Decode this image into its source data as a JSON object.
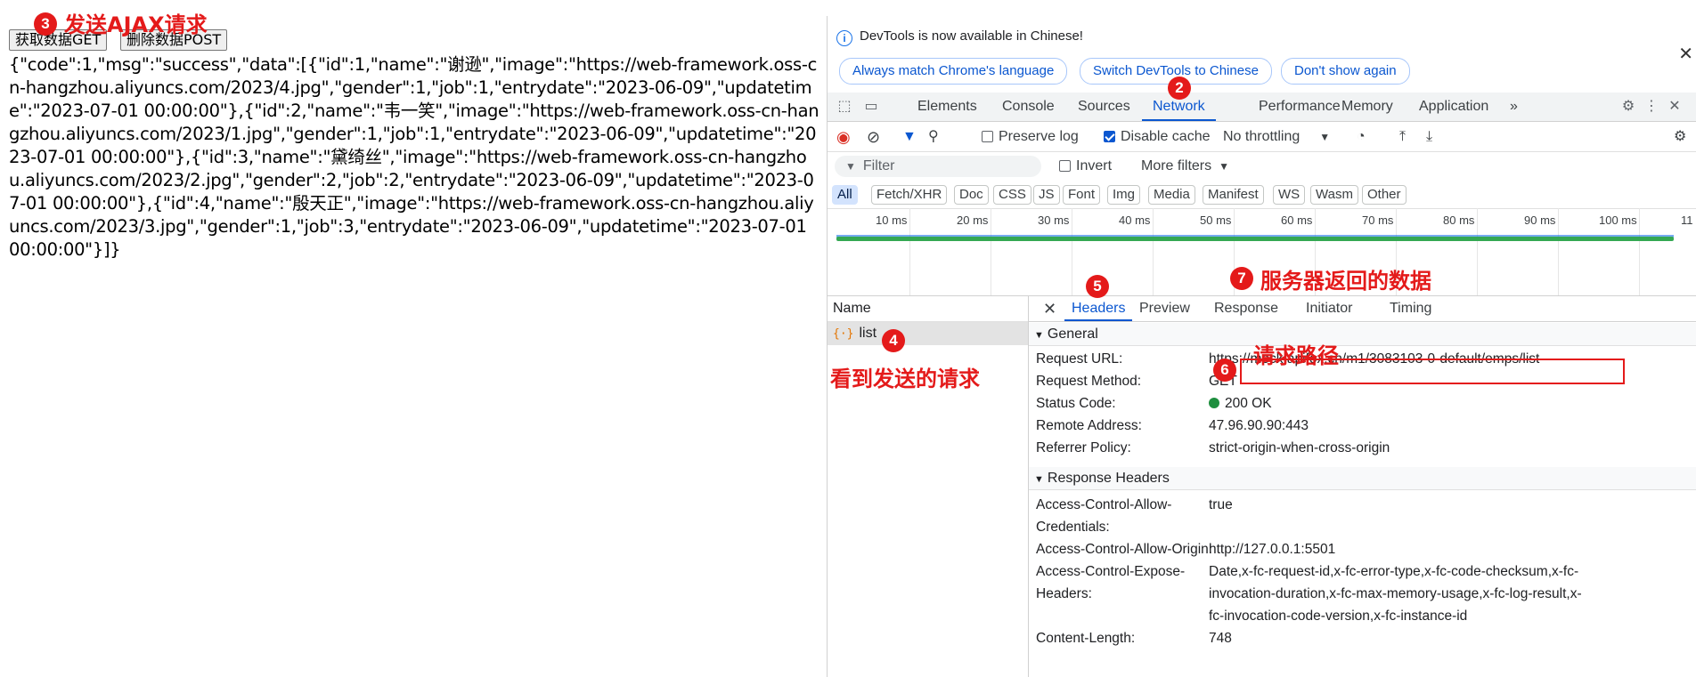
{
  "page": {
    "get_button": "获取数据GET",
    "post_button": "删除数据POST",
    "response_text": "{\"code\":1,\"msg\":\"success\",\"data\":[{\"id\":1,\"name\":\"谢逊\",\"image\":\"https://web-framework.oss-cn-hangzhou.aliyuncs.com/2023/4.jpg\",\"gender\":1,\"job\":1,\"entrydate\":\"2023-06-09\",\"updatetime\":\"2023-07-01 00:00:00\"},{\"id\":2,\"name\":\"韦一笑\",\"image\":\"https://web-framework.oss-cn-hangzhou.aliyuncs.com/2023/1.jpg\",\"gender\":1,\"job\":1,\"entrydate\":\"2023-06-09\",\"updatetime\":\"2023-07-01 00:00:00\"},{\"id\":3,\"name\":\"黛绮丝\",\"image\":\"https://web-framework.oss-cn-hangzhou.aliyuncs.com/2023/2.jpg\",\"gender\":2,\"job\":2,\"entrydate\":\"2023-06-09\",\"updatetime\":\"2023-07-01 00:00:00\"},{\"id\":4,\"name\":\"殷天正\",\"image\":\"https://web-framework.oss-cn-hangzhou.aliyuncs.com/2023/3.jpg\",\"gender\":1,\"job\":3,\"entrydate\":\"2023-06-09\",\"updatetime\":\"2023-07-01 00:00:00\"}]}"
  },
  "devtools": {
    "info_text": "DevTools is now available in Chinese!",
    "pill_match": "Always match Chrome's language",
    "pill_switch": "Switch DevTools to Chinese",
    "pill_dont": "Don't show again",
    "tabs": [
      "Elements",
      "Console",
      "Sources",
      "Network",
      "Performance",
      "Memory",
      "Application"
    ],
    "more_tabs": "»",
    "preserve_log": "Preserve log",
    "disable_cache": "Disable cache",
    "throttling": "No throttling",
    "filter_placeholder": "Filter",
    "invert": "Invert",
    "more_filters": "More filters",
    "types": [
      "All",
      "Fetch/XHR",
      "Doc",
      "CSS",
      "JS",
      "Font",
      "Img",
      "Media",
      "Manifest",
      "WS",
      "Wasm",
      "Other"
    ],
    "ticks": [
      "10 ms",
      "20 ms",
      "30 ms",
      "40 ms",
      "50 ms",
      "60 ms",
      "70 ms",
      "80 ms",
      "90 ms",
      "100 ms",
      "11"
    ],
    "name_header": "Name",
    "request_name": "list",
    "detail_tabs": [
      "Headers",
      "Preview",
      "Response",
      "Initiator",
      "Timing"
    ],
    "general_title": "General",
    "general": {
      "request_url_label": "Request URL:",
      "request_url": "https://mock.apifox.cn/m1/3083103-0-default/emps/list",
      "method_label": "Request Method:",
      "method": "GET",
      "status_label": "Status Code:",
      "status": "200 OK",
      "remote_label": "Remote Address:",
      "remote": "47.96.90.90:443",
      "referrer_label": "Referrer Policy:",
      "referrer": "strict-origin-when-cross-origin"
    },
    "response_headers_title": "Response Headers",
    "response_headers": {
      "acac_label1": "Access-Control-Allow-",
      "acac_label2": "Credentials:",
      "acac": "true",
      "acao_label": "Access-Control-Allow-Origin:",
      "acao": "http://127.0.0.1:5501",
      "aceh_label1": "Access-Control-Expose-",
      "aceh_label2": "Headers:",
      "aceh1": "Date,x-fc-request-id,x-fc-error-type,x-fc-code-checksum,x-fc-",
      "aceh2": "invocation-duration,x-fc-max-memory-usage,x-fc-log-result,x-",
      "aceh3": "fc-invocation-code-version,x-fc-instance-id",
      "cl_label": "Content-Length:",
      "cl": "748"
    }
  },
  "annotations": {
    "n1": "2",
    "n2": "3",
    "n3": "4",
    "n4": "5",
    "n5": "6",
    "n6": "7",
    "send_ajax": "发送AJAX请求",
    "see_request": "看到发送的请求",
    "request_path": "请求路径",
    "server_data": "服务器返回的数据"
  },
  "colors": {
    "accent": "#0b57d0",
    "annotation": "#e41a1a",
    "status_ok": "#1e8e3e"
  }
}
